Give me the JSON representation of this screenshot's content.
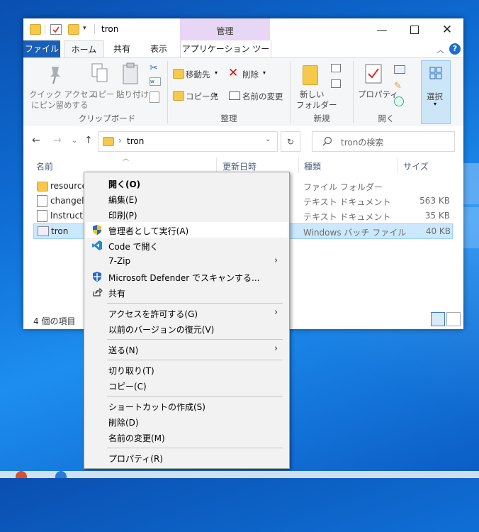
{
  "window": {
    "title": "tron",
    "manage_label": "管理",
    "tabs": {
      "file": "ファイル",
      "home": "ホーム",
      "share": "共有",
      "view": "表示",
      "app_tools": "アプリケーション ツール"
    },
    "help_glyph": "?"
  },
  "ribbon": {
    "pin_quick_access": [
      "クイック アクセス",
      "にピン留めする"
    ],
    "copy": "コピー",
    "paste": "貼り付け",
    "move_to": "移動先",
    "copy_to": "コピー先",
    "delete": "削除",
    "rename": "名前の変更",
    "new_folder": [
      "新しい",
      "フォルダー"
    ],
    "properties": "プロパティ",
    "select": "選択",
    "groups": {
      "clipboard": "クリップボード",
      "organize": "整理",
      "new": "新規",
      "open": "開く"
    }
  },
  "address": {
    "path": "tron",
    "search_placeholder": "tronの検索"
  },
  "columns": {
    "name": "名前",
    "modified": "更新日時",
    "type": "種類",
    "size": "サイズ"
  },
  "files": [
    {
      "name": "resources",
      "type": "ファイル フォルダー",
      "size": ""
    },
    {
      "name": "changelo",
      "type": "テキスト ドキュメント",
      "size": "563 KB"
    },
    {
      "name": "Instructio",
      "type": "テキスト ドキュメント",
      "size": "35 KB"
    },
    {
      "name": "tron",
      "type": "Windows バッチ ファイル",
      "size": "40 KB"
    }
  ],
  "status": {
    "item_count": "4 個の項目"
  },
  "context_menu": {
    "open": "開く(O)",
    "edit": "編集(E)",
    "print": "印刷(P)",
    "run_as_admin": "管理者として実行(A)",
    "open_with_code": "Code で開く",
    "seven_zip": "7-Zip",
    "defender": "Microsoft Defender でスキャンする...",
    "share": "共有",
    "give_access": "アクセスを許可する(G)",
    "restore_versions": "以前のバージョンの復元(V)",
    "send_to": "送る(N)",
    "cut": "切り取り(T)",
    "copy": "コピー(C)",
    "create_shortcut": "ショートカットの作成(S)",
    "delete": "削除(D)",
    "rename": "名前の変更(M)",
    "properties": "プロパティ(R)"
  },
  "colors": {
    "file_tab": "#1a5fb4",
    "manage_band": "#e8d6f5",
    "selection": "#cce8ff",
    "desktop": "#0f6fd6"
  }
}
